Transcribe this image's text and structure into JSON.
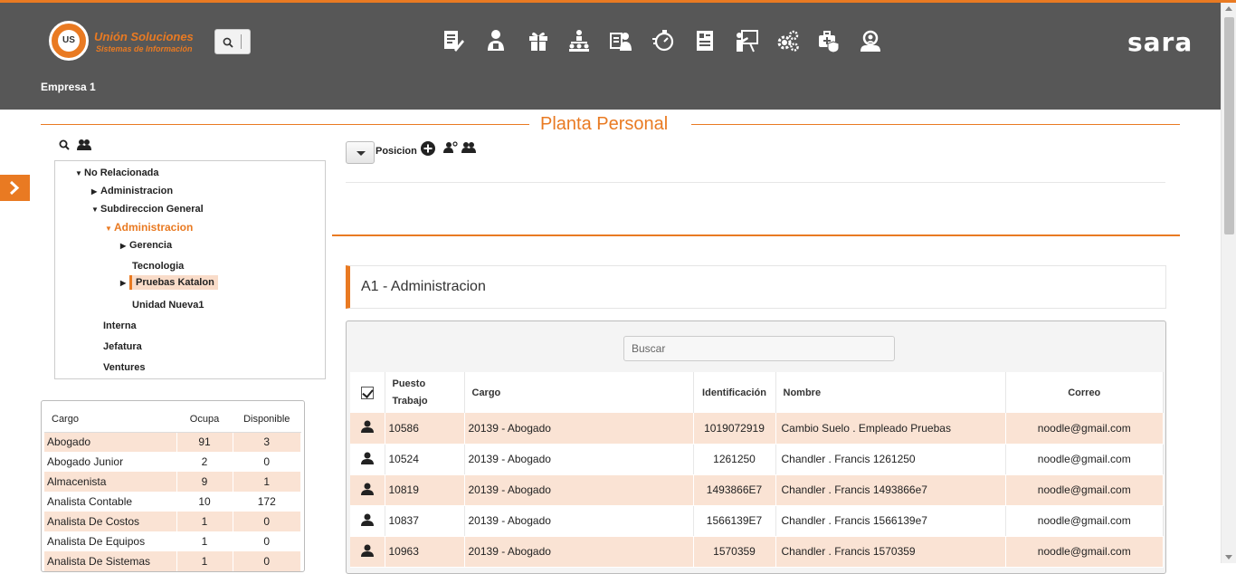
{
  "header": {
    "logo_mark": "US",
    "logo_title": "Unión Soluciones",
    "logo_subtitle": "Sistemas de Información",
    "brand": "sara",
    "empresa": "Empresa 1",
    "module_icons": [
      "document-edit-icon",
      "user-admin-icon",
      "gift-icon",
      "org-chart-icon",
      "user-card-icon",
      "stopwatch-icon",
      "resume-icon",
      "presentation-icon",
      "gears-icon",
      "medical-case-icon",
      "user-search-icon"
    ],
    "accent_color": "#e97a22",
    "header_color": "#575757"
  },
  "page": {
    "title": "Planta Personal"
  },
  "tree": {
    "nodes": [
      {
        "label": "No Relacionada",
        "caret": "down"
      },
      {
        "label": "Administracion",
        "caret": "right"
      },
      {
        "label": "Subdireccion General",
        "caret": "down"
      },
      {
        "label": "Administracion",
        "caret": "down"
      },
      {
        "label": "Gerencia",
        "caret": "right"
      },
      {
        "label": "Tecnologia",
        "caret": ""
      },
      {
        "label": "Pruebas Katalon",
        "caret": "right"
      },
      {
        "label": "Unidad Nueva1",
        "caret": ""
      },
      {
        "label": "Interna",
        "caret": ""
      },
      {
        "label": "Jefatura",
        "caret": ""
      },
      {
        "label": "Ventures",
        "caret": ""
      }
    ]
  },
  "cargo_table": {
    "headers": [
      "Cargo",
      "Ocupa",
      "Disponible"
    ],
    "rows": [
      [
        "Abogado",
        "91",
        "3"
      ],
      [
        "Abogado Junior",
        "2",
        "0"
      ],
      [
        "Almacenista",
        "9",
        "1"
      ],
      [
        "Analista Contable",
        "10",
        "172"
      ],
      [
        "Analista De Costos",
        "1",
        "0"
      ],
      [
        "Analista De Equipos",
        "1",
        "0"
      ],
      [
        "Analista De Sistemas",
        "1",
        "0"
      ]
    ]
  },
  "toolbar": {
    "posicion_label": "Posicion"
  },
  "unit": {
    "title": "A1 - Administracion"
  },
  "grid": {
    "search_placeholder": "Buscar",
    "headers": [
      "Puesto Trabajo",
      "Cargo",
      "Identificación",
      "Nombre",
      "Correo"
    ],
    "rows": [
      [
        "10586",
        "20139 - Abogado",
        "1019072919",
        "Cambio Suelo . Empleado Pruebas",
        "noodle@gmail.com"
      ],
      [
        "10524",
        "20139 - Abogado",
        "1261250",
        "Chandler . Francis 1261250",
        "noodle@gmail.com"
      ],
      [
        "10819",
        "20139 - Abogado",
        "1493866E7",
        "Chandler . Francis 1493866e7",
        "noodle@gmail.com"
      ],
      [
        "10837",
        "20139 - Abogado",
        "1566139E7",
        "Chandler . Francis 1566139e7",
        "noodle@gmail.com"
      ],
      [
        "10963",
        "20139 - Abogado",
        "1570359",
        "Chandler . Francis 1570359",
        "noodle@gmail.com"
      ]
    ]
  }
}
